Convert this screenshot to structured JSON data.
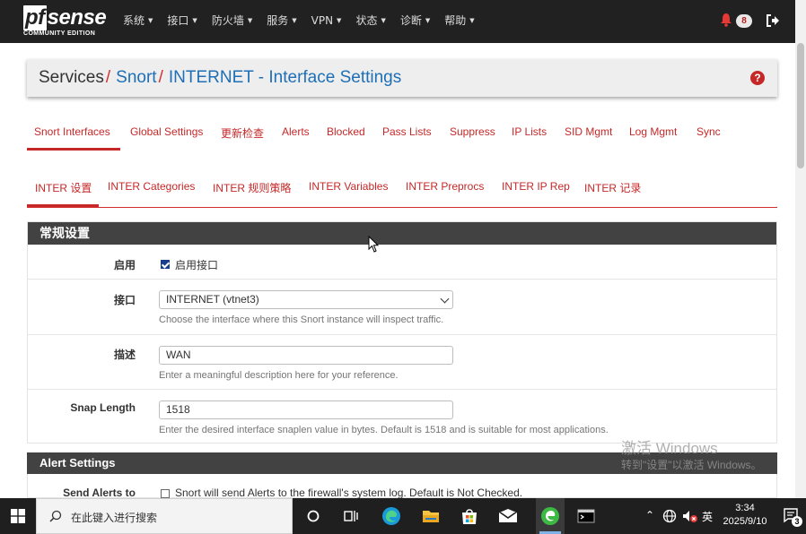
{
  "navbar": {
    "brand": {
      "logo_pf": "pf",
      "logo_rest": "sense",
      "edition": "COMMUNITY EDITION"
    },
    "menu": [
      "系统",
      "接口",
      "防火墙",
      "服务",
      "VPN",
      "状态",
      "诊断",
      "帮助"
    ],
    "notification_count": "8"
  },
  "breadcrumb": {
    "root": "Services",
    "sep1": "/",
    "section": "Snort",
    "sep2": "/",
    "page": "INTERNET - Interface Settings",
    "help": "?"
  },
  "tabs_primary": [
    "Snort Interfaces",
    "Global Settings",
    "更新检查",
    "Alerts",
    "Blocked",
    "Pass Lists",
    "Suppress",
    "IP Lists",
    "SID Mgmt",
    "Log Mgmt",
    "Sync"
  ],
  "tabs_secondary": [
    "INTER 设置",
    "INTER Categories",
    "INTER 规则策略",
    "INTER Variables",
    "INTER Preprocs",
    "INTER IP Rep",
    "INTER 记录"
  ],
  "general": {
    "title": "常规设置",
    "enable": {
      "label": "启用",
      "checkbox_label": "启用接口",
      "checked": true
    },
    "interface": {
      "label": "接口",
      "value": "INTERNET (vtnet3)",
      "help": "Choose the interface where this Snort instance will inspect traffic."
    },
    "description": {
      "label": "描述",
      "value": "WAN",
      "help": "Enter a meaningful description here for your reference."
    },
    "snaplen": {
      "label": "Snap Length",
      "value": "1518",
      "help": "Enter the desired interface snaplen value in bytes. Default is 1518 and is suitable for most applications."
    }
  },
  "alert": {
    "title": "Alert Settings",
    "send_alerts": {
      "label": "Send Alerts to",
      "checkbox_label": "Snort will send Alerts to the firewall's system log. Default is Not Checked.",
      "checked": false
    }
  },
  "watermark": {
    "line1": "激活 Windows",
    "line2": "转到\"设置\"以激活 Windows。"
  },
  "taskbar": {
    "search_placeholder": "在此键入进行搜索",
    "ime": "英",
    "time": "3:34",
    "date": "2025/9/10",
    "notification_count": "3"
  },
  "colors": {
    "accent": "#c62828",
    "link": "#1e6fb5",
    "navbar": "#212121",
    "panel_header": "#424242"
  }
}
